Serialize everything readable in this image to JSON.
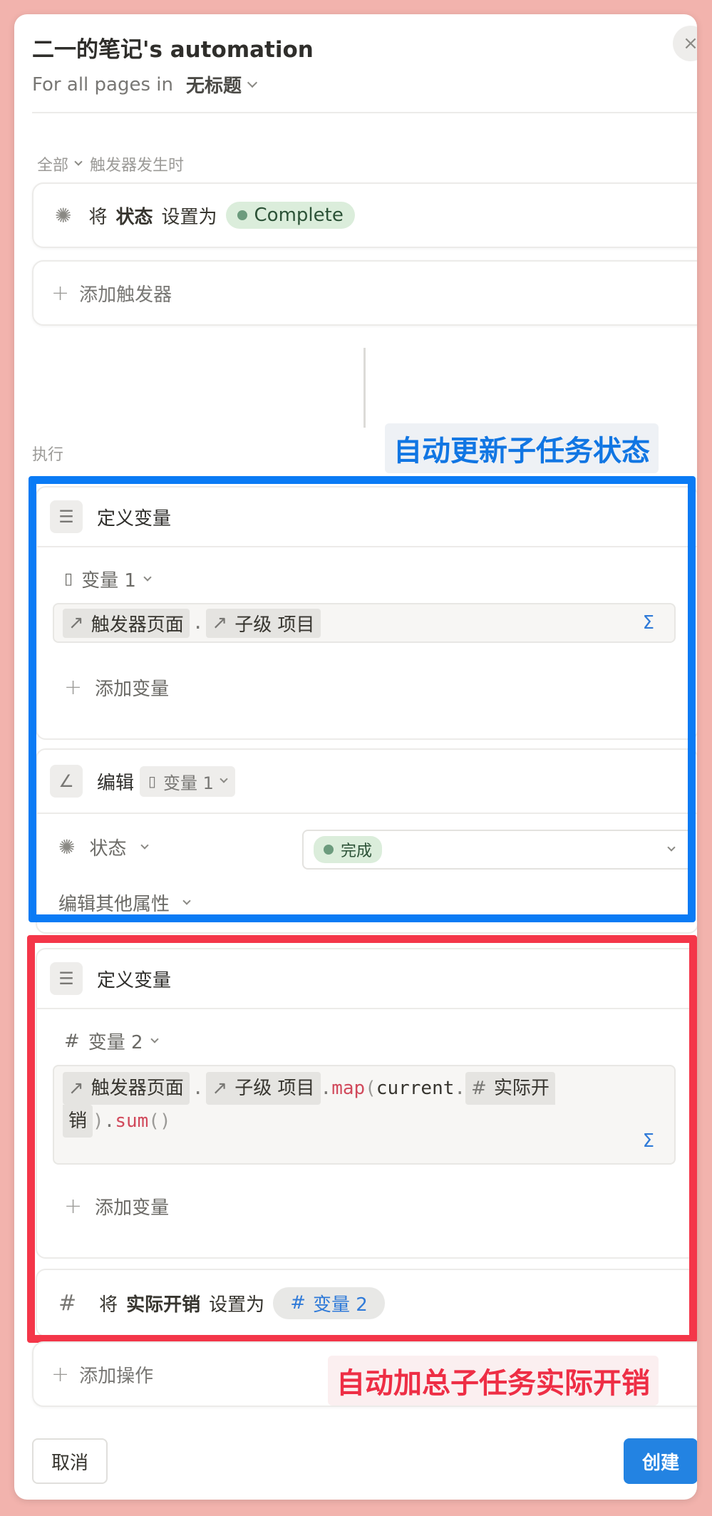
{
  "header": {
    "title": "二一的笔记's automation",
    "scope_prefix": "For all pages in",
    "database": "无标题"
  },
  "trigger": {
    "section_all": "全部",
    "section_when": "触发器发生时",
    "action_verb": "将",
    "property": "状态",
    "set_to": "设置为",
    "value": "Complete",
    "add_trigger": "添加触发器"
  },
  "execute": {
    "label": "执行",
    "block1": {
      "title": "定义变量",
      "variable_name": "变量 1",
      "formula": {
        "chip1": "触发器页面",
        "chip2": "子级 项目"
      },
      "sigma": "Σ",
      "add_variable": "添加变量"
    },
    "block2": {
      "title": "编辑",
      "target": "变量 1",
      "property": "状态",
      "value": "完成",
      "edit_other": "编辑其他属性"
    },
    "block3": {
      "title": "定义变量",
      "variable_name": "变量 2",
      "formula": {
        "chip1": "触发器页面",
        "chip2": "子级 项目",
        "method": "map",
        "arg": "current",
        "chip3_a": "实际开",
        "chip3_b": "销",
        "sum": "sum"
      },
      "sigma": "Σ",
      "add_variable": "添加变量"
    },
    "block4": {
      "verb": "将",
      "property": "实际开销",
      "set_to": "设置为",
      "value": "变量 2"
    },
    "add_action": "添加操作"
  },
  "annotations": {
    "blue": "自动更新子任务状态",
    "red": "自动加总子任务实际开销"
  },
  "footer": {
    "cancel": "取消",
    "create": "创建"
  },
  "colors": {
    "accent_blue": "#2383e2",
    "annot_blue": "#0a7bf5",
    "annot_red": "#f43649",
    "status_green": "#dbeddb"
  }
}
